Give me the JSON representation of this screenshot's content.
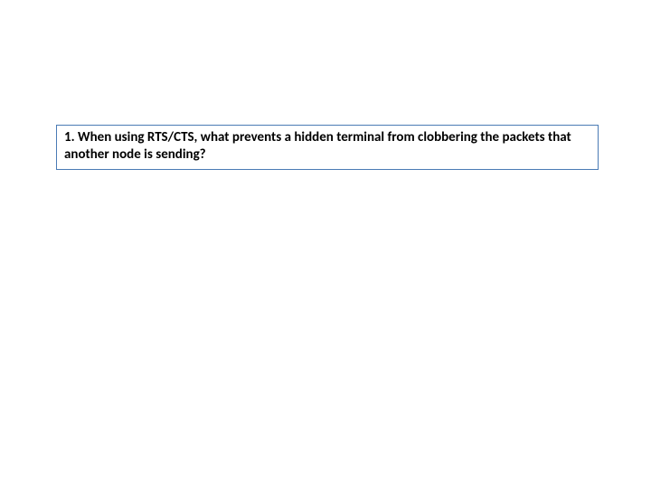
{
  "question": {
    "text": "1. When using RTS/CTS, what prevents a hidden terminal from clobbering the packets that another node is sending?"
  },
  "colors": {
    "border": "#4a7bb5",
    "text": "#000000",
    "background": "#ffffff"
  }
}
